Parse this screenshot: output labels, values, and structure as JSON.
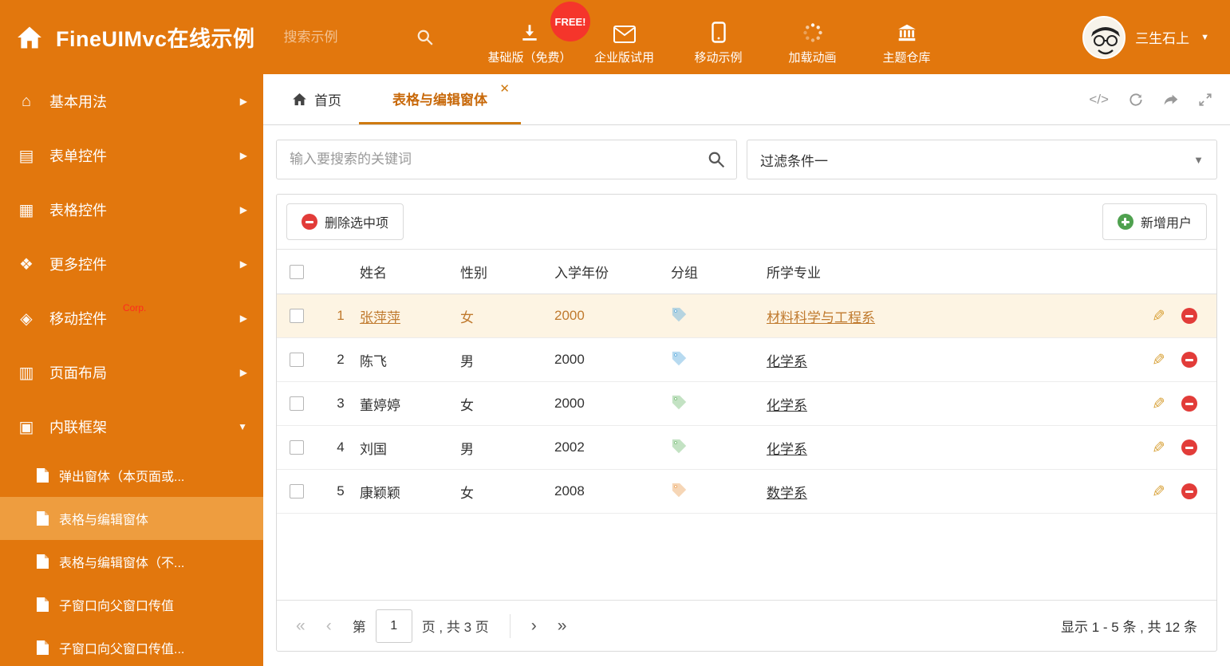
{
  "header": {
    "brand": "FineUIMvc在线示例",
    "search_placeholder": "搜索示例",
    "free_badge": "FREE!",
    "nav": [
      {
        "label": "基础版（免费）",
        "icon": "download-icon"
      },
      {
        "label": "企业版试用",
        "icon": "mail-icon"
      },
      {
        "label": "移动示例",
        "icon": "mobile-icon"
      },
      {
        "label": "加载动画",
        "icon": "spinner-icon"
      },
      {
        "label": "主题仓库",
        "icon": "bank-icon"
      }
    ],
    "user_name": "三生石上"
  },
  "sidebar": {
    "items": [
      {
        "label": "基本用法",
        "icon": "home-icon"
      },
      {
        "label": "表单控件",
        "icon": "form-icon"
      },
      {
        "label": "表格控件",
        "icon": "table-icon"
      },
      {
        "label": "更多控件",
        "icon": "widgets-icon"
      },
      {
        "label": "移动控件",
        "icon": "mobile-icon",
        "badge": "Corp."
      },
      {
        "label": "页面布局",
        "icon": "layout-icon"
      },
      {
        "label": "内联框架",
        "icon": "frame-icon",
        "expanded": true
      }
    ],
    "subitems": [
      {
        "label": "弹出窗体（本页面或..."
      },
      {
        "label": "表格与编辑窗体",
        "active": true
      },
      {
        "label": "表格与编辑窗体（不..."
      },
      {
        "label": "子窗口向父窗口传值"
      },
      {
        "label": "子窗口向父窗口传值..."
      }
    ]
  },
  "tabs": {
    "home": "首页",
    "active": "表格与编辑窗体"
  },
  "filters": {
    "search_placeholder": "输入要搜索的关键词",
    "filter_selected": "过滤条件一"
  },
  "toolbar": {
    "delete_label": "删除选中项",
    "add_label": "新增用户"
  },
  "table": {
    "headers": {
      "name": "姓名",
      "gender": "性别",
      "year": "入学年份",
      "group": "分组",
      "major": "所学专业"
    },
    "rows": [
      {
        "num": "1",
        "name": "张萍萍",
        "gender": "女",
        "year": "2000",
        "tag": "blue",
        "major": "材料科学与工程系",
        "selected": true
      },
      {
        "num": "2",
        "name": "陈飞",
        "gender": "男",
        "year": "2000",
        "tag": "blue",
        "major": "化学系"
      },
      {
        "num": "3",
        "name": "董婷婷",
        "gender": "女",
        "year": "2000",
        "tag": "green",
        "major": "化学系"
      },
      {
        "num": "4",
        "name": "刘国",
        "gender": "男",
        "year": "2002",
        "tag": "green",
        "major": "化学系"
      },
      {
        "num": "5",
        "name": "康颖颖",
        "gender": "女",
        "year": "2008",
        "tag": "orange",
        "major": "数学系"
      }
    ]
  },
  "pagination": {
    "prefix": "第",
    "page": "1",
    "suffix": "页 , 共 3 页",
    "summary": "显示 1 - 5 条 , 共 12 条"
  },
  "colors": {
    "primary": "#e2770d",
    "sidebar_selected": "#ee9d3f",
    "free_badge": "#f5352b",
    "active_tab": "#c8690a",
    "selected_row_bg": "#fdf4e3",
    "selected_row_text": "#c07a2e",
    "delete_red": "#e23c39",
    "add_green": "#4fa14f",
    "tag_blue": "#62aede",
    "tag_green": "#7cbf7c",
    "tag_orange": "#eda55f"
  }
}
